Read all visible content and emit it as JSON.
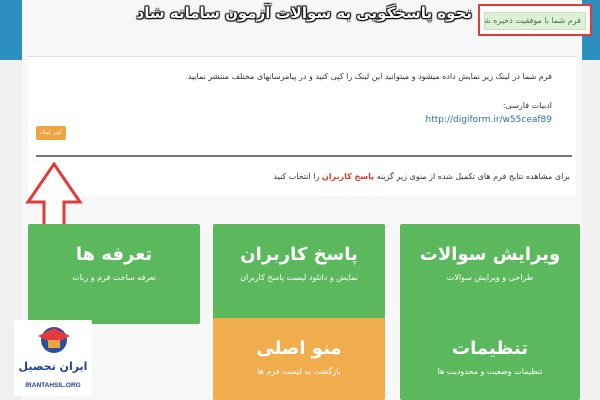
{
  "overlay_title": "نحوه پاسخگویی به سوالات آزمون سامانه شاد",
  "alert": {
    "success_text": "فرم شما با موفقیت ذخیره شد"
  },
  "share": {
    "description": "فرم شما در لینک زیر نمایش داده میشود و میتوانید این لینک را کپی کنید و در پیامرسانهای مختلف منتشر نمایید",
    "persian_label": "ادبیات فارسی:",
    "link_url": "http://digiform.ir/w55ceaf89",
    "copy_button_label": "کپی لینک"
  },
  "results_note": {
    "text_before": "برای مشاهده نتایج فرم های تکمیل شده از منوی زیر گزینه ",
    "highlight": "پاسخ کاربران",
    "text_after": " را انتخاب کنید"
  },
  "tiles": [
    {
      "title": "ویرایش سوالات",
      "subtitle": "طراحی و ویرایش سوالات",
      "color": "#5cb85c"
    },
    {
      "title": "پاسخ کاربران",
      "subtitle": "نمایش و دانلود لیست پاسخ کاربران",
      "color": "#5cb85c"
    },
    {
      "title": "تعرفه ها",
      "subtitle": "تعرفه ساخت فرم و ربات",
      "color": "#5cb85c"
    },
    {
      "title": "تنظیمات",
      "subtitle": "تنظیمات وضعیت و محدودیت ها",
      "color": "#5cb85c"
    },
    {
      "title": "منو اصلی",
      "subtitle": "بازگشت به لیست فرم ها",
      "color": "#f0ad4e"
    }
  ],
  "watermark": {
    "brand": "ایران تحصیل",
    "url": "IRANTAHSIL.ORG"
  },
  "colors": {
    "accent_red": "#e23b3b",
    "arrow_red": "#e23b3b",
    "header_blue": "#2d8fbf"
  }
}
